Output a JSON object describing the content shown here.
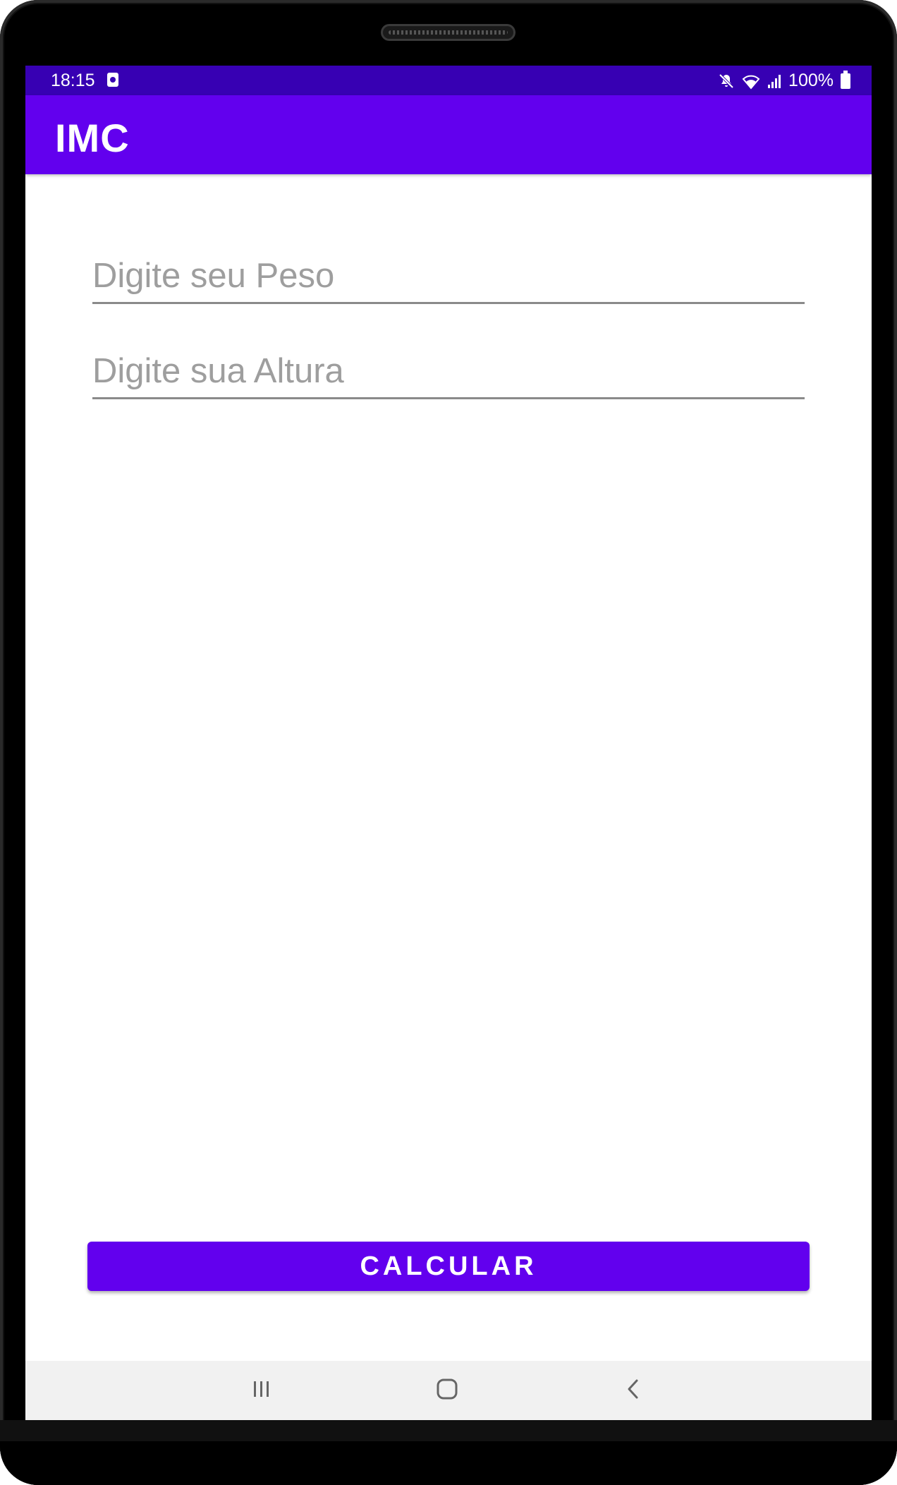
{
  "status_bar": {
    "time": "18:15",
    "battery_percent": "100%",
    "icons": [
      "notification-icon",
      "mute-icon",
      "wifi-icon",
      "signal-icon",
      "battery-icon"
    ]
  },
  "app_bar": {
    "title": "IMC"
  },
  "form": {
    "peso_placeholder": "Digite seu Peso",
    "peso_value": "",
    "altura_placeholder": "Digite sua Altura",
    "altura_value": ""
  },
  "actions": {
    "calcular_label": "CALCULAR"
  },
  "nav_bar": {
    "icons": [
      "recents-icon",
      "home-icon",
      "back-icon"
    ]
  },
  "colors": {
    "status_bar": "#3700b3",
    "primary": "#6200ee",
    "nav_bar": "#f1f1f1"
  }
}
